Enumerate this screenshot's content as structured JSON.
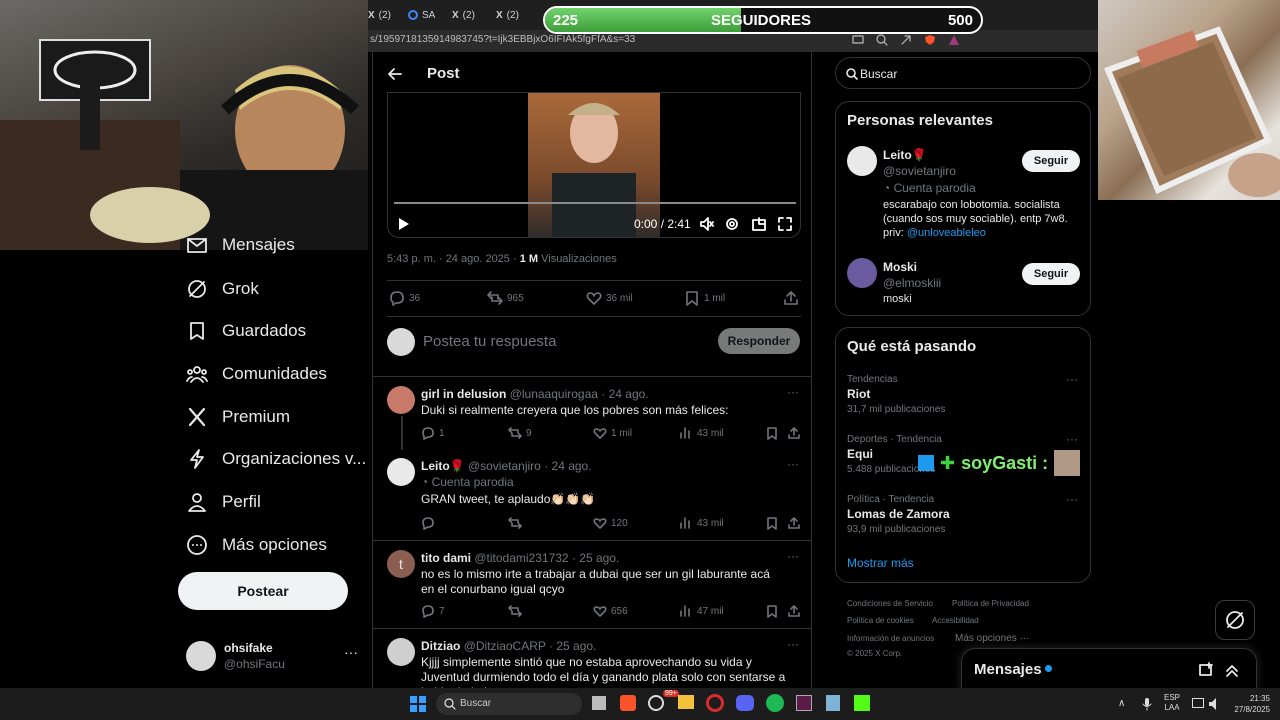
{
  "browser": {
    "tabs": [
      {
        "label": "(2)"
      },
      {
        "label": "SA"
      },
      {
        "label": "(2)"
      },
      {
        "label": "(2)"
      }
    ],
    "url": "s/1959718135914983745?t=Ijk3EBBjxO6IFIAk5fgFfA&s=33"
  },
  "overlay": {
    "followers_current": "225",
    "followers_label": "SEGUIDORES",
    "followers_goal": "500",
    "progress": 0.45,
    "streamer_tag": "soyGasti :"
  },
  "nav": {
    "items": [
      {
        "label": "Mensajes"
      },
      {
        "label": "Grok"
      },
      {
        "label": "Guardados"
      },
      {
        "label": "Comunidades"
      },
      {
        "label": "Premium"
      },
      {
        "label": "Organizaciones v..."
      },
      {
        "label": "Perfil"
      },
      {
        "label": "Más opciones"
      }
    ],
    "post_button": "Postear",
    "account": {
      "name": "ohsifake",
      "handle": "@ohsiFacu"
    }
  },
  "post": {
    "header_title": "Post",
    "video_time": "0:00 / 2:41",
    "timestamp": "5:43 p. m. · 24 ago. 2025 ·",
    "views_count": "1 M",
    "views_label": "Visualizaciones",
    "stats": {
      "replies": "36",
      "reposts": "965",
      "likes": "36 mil",
      "bookmarks": "1 mil"
    },
    "reply_placeholder": "Postea tu respuesta",
    "reply_button": "Responder"
  },
  "replies": [
    {
      "name": "girl in delusion",
      "handle": "@lunaaquirogaa",
      "date": "· 24 ago.",
      "badge": "",
      "text": "Duki si realmente creyera que los pobres son más felices:",
      "replies": "1",
      "reposts": "9",
      "likes": "1 mil",
      "views": "43 mil"
    },
    {
      "name": "Leito🌹",
      "handle": "@sovietanjiro",
      "date": "· 24 ago.",
      "badge": "Cuenta parodia",
      "text": "GRAN tweet, te aplaudo👏🏻👏🏻👏🏻",
      "replies": "",
      "reposts": "",
      "likes": "120",
      "views": "43 mil"
    },
    {
      "name": "tito dami",
      "handle": "@titodami231732",
      "date": "· 25 ago.",
      "badge": "",
      "text": "no es lo mismo irte a trabajar a dubai que ser un gil laburante acá en el conurbano igual qcyo",
      "replies": "7",
      "reposts": "",
      "likes": "656",
      "views": "47 mil"
    },
    {
      "name": "Ditziao",
      "handle": "@DitziaoCARP",
      "date": "· 25 ago.",
      "badge": "",
      "text": "Kjjjj simplemente sintió que no estaba aprovechando su vida y Juventud durmiendo todo el día y ganando plata solo con sentarse a hablar boludeces",
      "replies": "",
      "reposts": "",
      "likes": "",
      "views": ""
    }
  ],
  "sidebar": {
    "search_placeholder": "Buscar",
    "relevant_title": "Personas relevantes",
    "people": [
      {
        "name": "Leito🌹",
        "handle": "@sovietanjiro",
        "badge": "Cuenta parodia",
        "bio": "escarabajo con lobotomia. socialista (cuando sos muy sociable). entp 7w8. priv:",
        "bio_link": "@unloveableleo",
        "follow": "Seguir"
      },
      {
        "name": "Moski",
        "handle": "@elmoskiii",
        "badge": "",
        "bio": "moski",
        "bio_link": "",
        "follow": "Seguir"
      }
    ],
    "trends_title": "Qué está pasando",
    "trends": [
      {
        "context": "Tendencias",
        "name": "Riot",
        "count": "31,7 mil publicaciones"
      },
      {
        "context": "Deportes · Tendencia",
        "name": "Equi",
        "count": "5.488 publicaciones"
      },
      {
        "context": "Política · Tendencia",
        "name": "Lomas de Zamora",
        "count": "93,9 mil publicaciones"
      }
    ],
    "show_more": "Mostrar más",
    "footer": [
      "Condiciones de Servicio",
      "Política de Privacidad",
      "Política de cookies",
      "Accesibilidad",
      "Información de anuncios",
      "Más opciones ···",
      "© 2025 X Corp."
    ],
    "messages_label": "Mensajes"
  },
  "taskbar": {
    "search": "Buscar",
    "lang1": "ESP",
    "lang2": "LAA",
    "time": "21:35",
    "date": "27/8/2025",
    "badge": "99+"
  },
  "colors": {
    "accent": "#1d9bf0",
    "bg": "#000000",
    "border": "#2f3336",
    "muted": "#71767b",
    "progress_green": "#4caf50"
  }
}
